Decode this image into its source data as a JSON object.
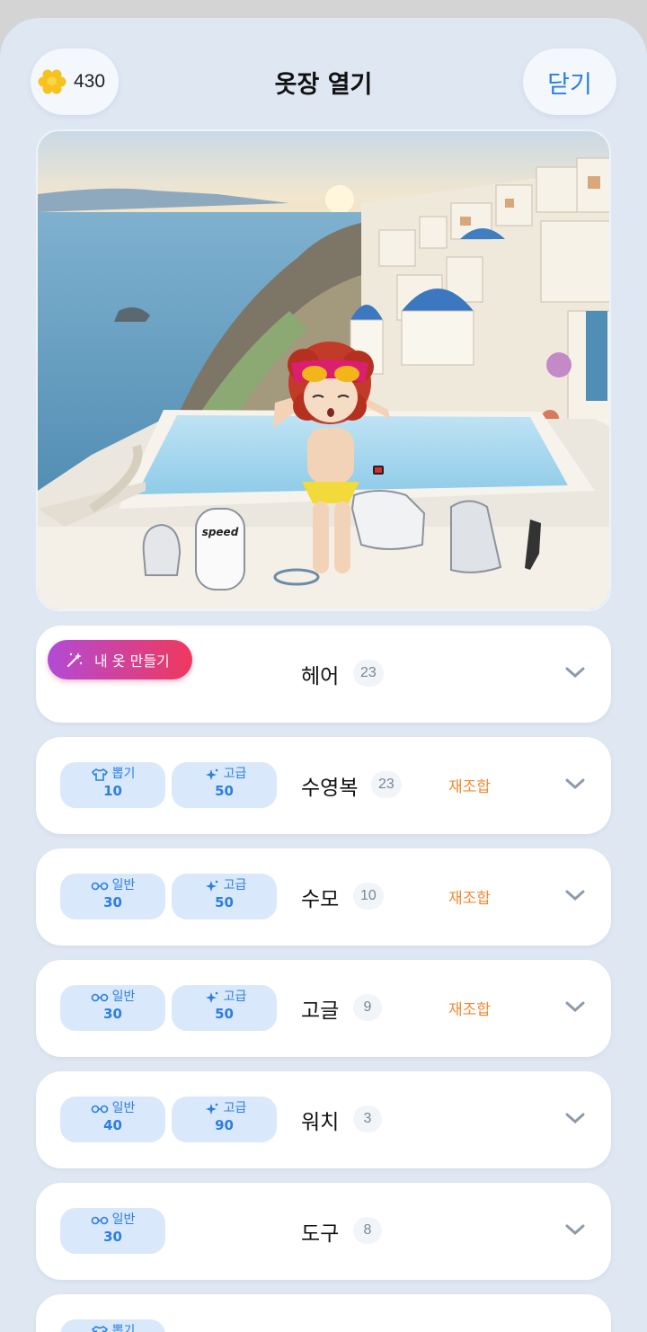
{
  "header": {
    "coins": "430",
    "title": "옷장 열기",
    "close_label": "닫기"
  },
  "scene": {
    "board_brand": "speed"
  },
  "make_button_label": "내 옷 만들기",
  "categories": [
    {
      "name": "헤어",
      "count": "23"
    },
    {
      "name": "수영복",
      "count": "23",
      "remix": "재조합",
      "chips": [
        {
          "icon": "shirt-icon",
          "label": "뽑기",
          "value": "10"
        },
        {
          "icon": "sparkle-icon",
          "label": "고급",
          "value": "50"
        }
      ]
    },
    {
      "name": "수모",
      "count": "10",
      "remix": "재조합",
      "chips": [
        {
          "icon": "glasses-icon",
          "label": "일반",
          "value": "30"
        },
        {
          "icon": "sparkle-icon",
          "label": "고급",
          "value": "50"
        }
      ]
    },
    {
      "name": "고글",
      "count": "9",
      "remix": "재조합",
      "chips": [
        {
          "icon": "glasses-icon",
          "label": "일반",
          "value": "30"
        },
        {
          "icon": "sparkle-icon",
          "label": "고급",
          "value": "50"
        }
      ]
    },
    {
      "name": "워치",
      "count": "3",
      "chips": [
        {
          "icon": "glasses-icon",
          "label": "일반",
          "value": "40"
        },
        {
          "icon": "sparkle-icon",
          "label": "고급",
          "value": "90"
        }
      ]
    },
    {
      "name": "도구",
      "count": "8",
      "chips": [
        {
          "icon": "glasses-icon",
          "label": "일반",
          "value": "30"
        }
      ]
    },
    {
      "chips": [
        {
          "icon": "shirt-icon",
          "label": "뽑기"
        }
      ]
    }
  ]
}
